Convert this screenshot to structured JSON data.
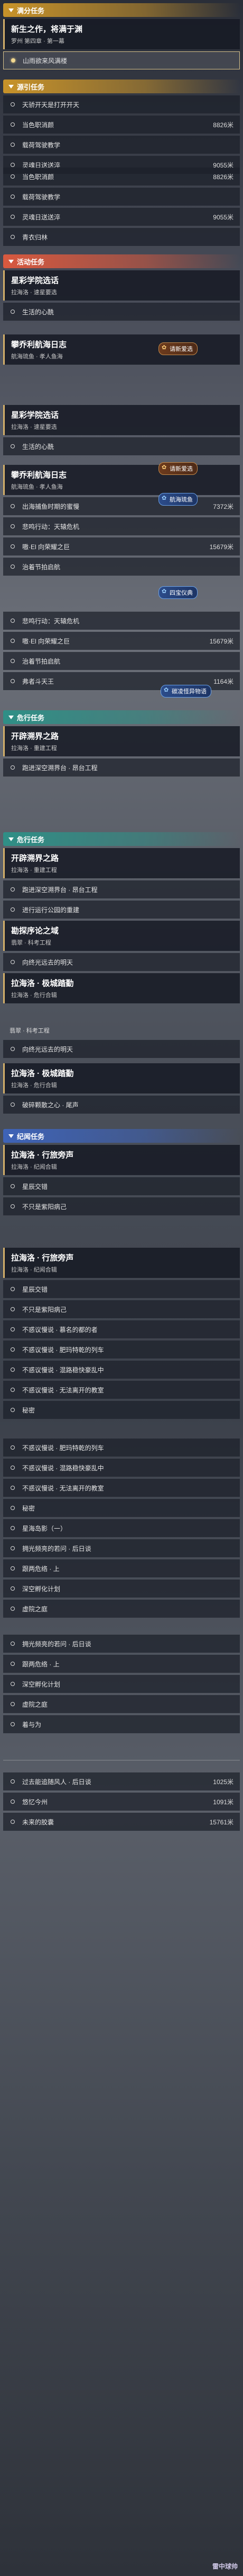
{
  "sec1": {
    "title": "满分任务"
  },
  "sec1_card": {
    "title": "新生之作，将满于渊",
    "sub": "罗州 第四章 · 第一幕"
  },
  "sec1_items": [
    {
      "label": "山雨欲来风满楼"
    }
  ],
  "sec2": {
    "title": "源引任务"
  },
  "sec2_items": [
    {
      "label": "天骄开天是打开开天",
      "num": ""
    },
    {
      "label": "当色职消颜",
      "num": "8826米"
    },
    {
      "label": "载荷驾驶教学",
      "num": ""
    },
    {
      "label": "灵魂日送送淬",
      "num": "9055米"
    }
  ],
  "sec2b_items": [
    {
      "label": "当色职消颜",
      "num": "8826米"
    },
    {
      "label": "载荷驾驶教学",
      "num": ""
    },
    {
      "label": "灵魂日送送淬",
      "num": "9055米"
    },
    {
      "label": "青衣归林",
      "num": ""
    }
  ],
  "sec3": {
    "title": "活动任务"
  },
  "sec3_card1": {
    "title": "星彩学院选话",
    "sub": "拉海洛 · 速星要选"
  },
  "sec3_items1": [
    {
      "label": "生活的心酰"
    }
  ],
  "sec3_card2": {
    "title": "攀乔利航海日志",
    "sub": "航海琉鱼 · 孝人鱼海"
  },
  "sec3_card3": {
    "title": "星彩学院选话",
    "sub": "拉海洛 · 速星要选"
  },
  "sec3_items2": [
    {
      "label": "生活的心酰"
    }
  ],
  "sec3_card4": {
    "title": "攀乔利航海日志",
    "sub": "航海琉鱼 · 孝人鱼海"
  },
  "sec3_items3": [
    {
      "label": "出海捕鱼时期的蜜慢",
      "num": "7372米"
    },
    {
      "label": "悲鸣行动：天辕危机",
      "num": ""
    },
    {
      "label": "嗷·El 向荣耀之巨",
      "num": "15679米"
    },
    {
      "label": "治着节拍启航",
      "num": ""
    }
  ],
  "sec3_items4": [
    {
      "label": "悲鸣行动：天辕危机",
      "num": ""
    },
    {
      "label": "嗷·El 向荣耀之巨",
      "num": "15679米"
    },
    {
      "label": "治着节拍启航",
      "num": ""
    },
    {
      "label": "弗者斗天王",
      "num": "1164米"
    }
  ],
  "tags": {
    "t1": "请新爱选",
    "t2": "请新爱选",
    "t3": "航海琉鱼",
    "t4": "四宝仪典",
    "t5": "碳凌怪异物语"
  },
  "sec4": {
    "title": "危行任务"
  },
  "sec4_card1": {
    "title": "开辟溯界之路",
    "sub": "拉海洛 · 重建工程"
  },
  "sec4_items1": [
    {
      "label": "跑进深空溯界台 · 昂台工程"
    }
  ],
  "sec4_card2": {
    "title": "开辟溯界之路",
    "sub": "拉海洛 · 重建工程"
  },
  "sec4_items2": [
    {
      "label": "跑进深空溯界台 · 昂台工程"
    },
    {
      "label": "进行运行公园的重建"
    }
  ],
  "sec4_card3": {
    "title": "勘探序论之域",
    "sub": "翡翠 · 科考工程"
  },
  "sec4_items3": [
    {
      "label": "向终光远去的明天"
    }
  ],
  "sec4_card4": {
    "title": "拉海洛 · 极城踏勤",
    "sub": "拉海洛 · 危行合辑"
  },
  "sec4_sub_label": "翡翠 · 科考工程",
  "sec4_items4": [
    {
      "label": "向终光远去的明天"
    }
  ],
  "sec4_card5": {
    "title": "拉海洛 · 极城踏勤",
    "sub": "拉海洛 · 危行合辑"
  },
  "sec4_items5": [
    {
      "label": "破碎颗散之心 · 尾声"
    }
  ],
  "sec5": {
    "title": "纪闻任务"
  },
  "sec5_card1": {
    "title": "拉海洛 · 行旅旁声",
    "sub": "拉海洛 · 纪闻合辑"
  },
  "sec5_items1": [
    {
      "label": "星辰交错"
    },
    {
      "label": "不只是紫阳病己"
    }
  ],
  "sec5_card2": {
    "title": "拉海洛 · 行旅旁声",
    "sub": "拉海洛 · 纪闻合辑"
  },
  "sec5_items2": [
    {
      "label": "星辰交错",
      "num": ""
    },
    {
      "label": "不只是紫阳病己",
      "num": ""
    },
    {
      "label": "不惑议慢说 · 慕名的都的者",
      "num": ""
    },
    {
      "label": "不惑议慢说 · 肥玛特乾的列车",
      "num": ""
    },
    {
      "label": "不惑议慢说 · 混路稳快豪乱中",
      "num": ""
    },
    {
      "label": "不惑议慢说 · 无法离开的教室",
      "num": ""
    },
    {
      "label": "秘密",
      "num": ""
    },
    {
      "label": "不惑议慢说 · 肥玛特乾的列车",
      "num": ""
    },
    {
      "label": "不惑议慢说 · 混路稳快豪乱中",
      "num": ""
    },
    {
      "label": "不惑议慢说 · 无法离开的教室",
      "num": ""
    },
    {
      "label": "秘密",
      "num": ""
    },
    {
      "label": "星海岛影（一）",
      "num": ""
    },
    {
      "label": "拥光频亮的若问 · 后日谈",
      "num": ""
    },
    {
      "label": "跟两危络 · 上",
      "num": ""
    },
    {
      "label": "深空孵化计划",
      "num": ""
    },
    {
      "label": "虚院之庭",
      "num": ""
    },
    {
      "label": "拥光频亮的若问 · 后日谈",
      "num": ""
    },
    {
      "label": "跟两危络 · 上",
      "num": ""
    },
    {
      "label": "深空孵化计划",
      "num": ""
    },
    {
      "label": "虚院之庭",
      "num": ""
    },
    {
      "label": "着与为",
      "num": ""
    },
    {
      "label": "过去能追随风人 · 后日谈",
      "num": "1025米"
    },
    {
      "label": "悠忆今州",
      "num": "1091米"
    },
    {
      "label": "未来的胶囊",
      "num": "15761米"
    }
  ],
  "watermark": "雷中球帅"
}
